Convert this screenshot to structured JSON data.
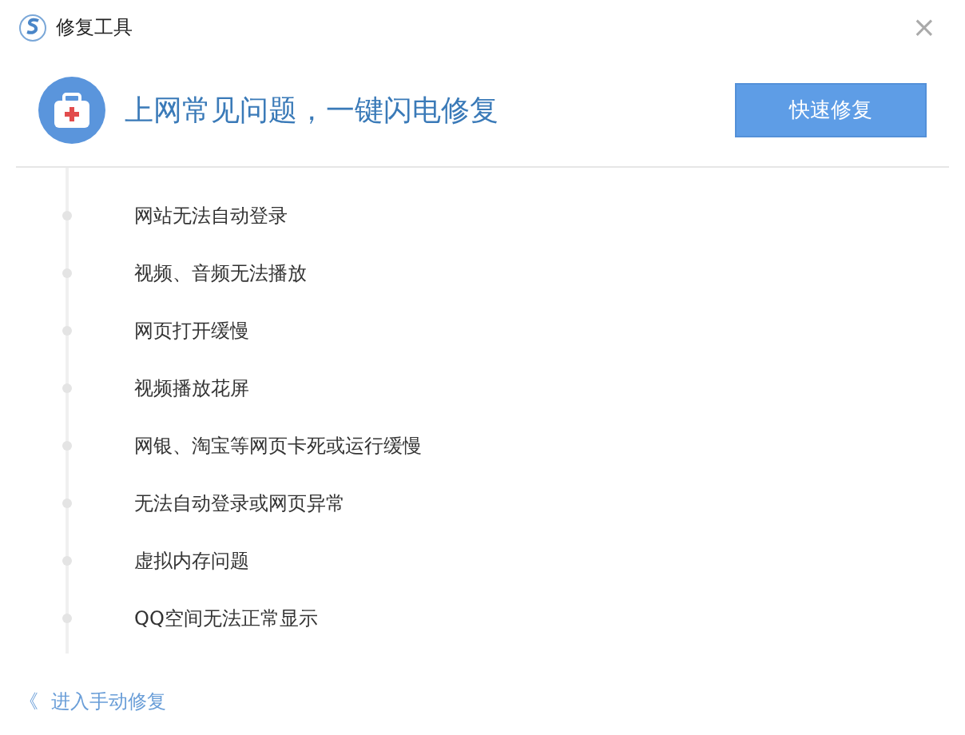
{
  "window": {
    "title": "修复工具",
    "close": "×"
  },
  "header": {
    "headline": "上网常见问题，一键闪电修复",
    "button": "快速修复"
  },
  "issues": [
    {
      "label": "网站无法自动登录"
    },
    {
      "label": "视频、音频无法播放"
    },
    {
      "label": "网页打开缓慢"
    },
    {
      "label": "视频播放花屏"
    },
    {
      "label": "网银、淘宝等网页卡死或运行缓慢"
    },
    {
      "label": "无法自动登录或网页异常"
    },
    {
      "label": "虚拟内存问题"
    },
    {
      "label": "QQ空间无法正常显示"
    }
  ],
  "footer": {
    "arrow": "《",
    "link": "进入手动修复"
  }
}
